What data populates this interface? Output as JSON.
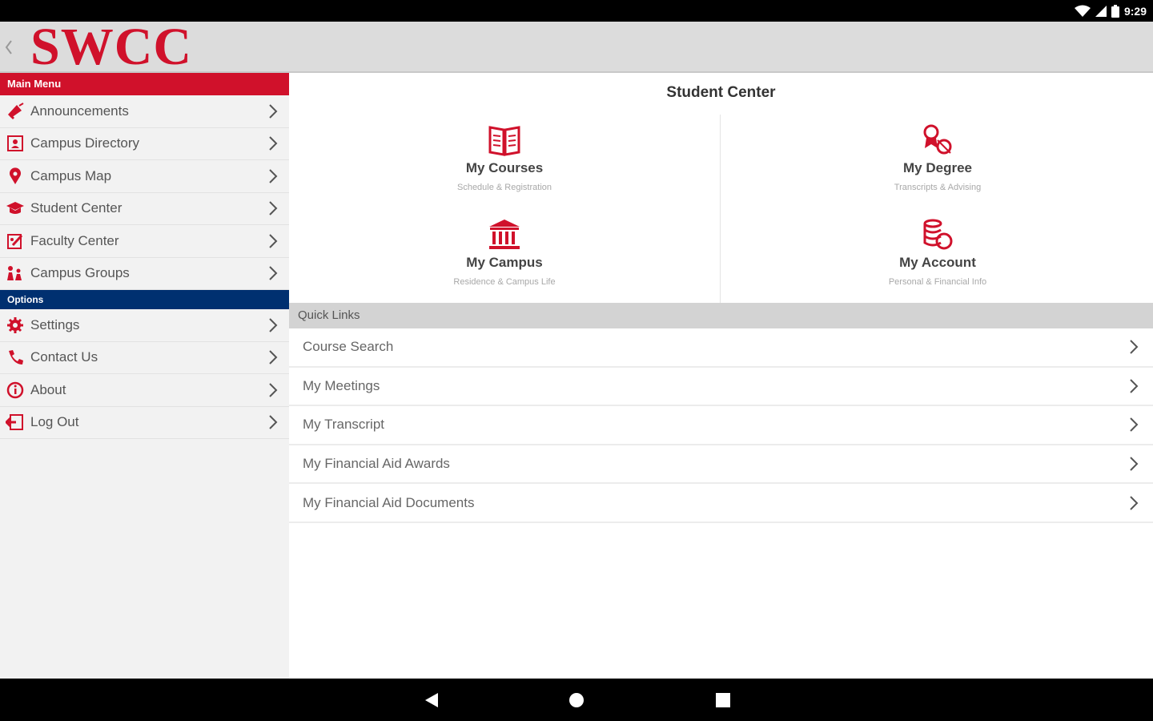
{
  "status_bar": {
    "time": "9:29"
  },
  "header": {
    "logo_text": "SWCC"
  },
  "sidebar": {
    "main_menu_label": "Main Menu",
    "main_items": [
      {
        "label": "Announcements",
        "icon": "megaphone-icon"
      },
      {
        "label": "Campus Directory",
        "icon": "contact-card-icon"
      },
      {
        "label": "Campus Map",
        "icon": "map-pin-icon"
      },
      {
        "label": "Student Center",
        "icon": "graduation-cap-icon"
      },
      {
        "label": "Faculty Center",
        "icon": "faculty-icon"
      },
      {
        "label": "Campus Groups",
        "icon": "groups-icon"
      }
    ],
    "options_label": "Options",
    "option_items": [
      {
        "label": "Settings",
        "icon": "gear-icon"
      },
      {
        "label": "Contact Us",
        "icon": "phone-icon"
      },
      {
        "label": "About",
        "icon": "info-icon"
      },
      {
        "label": "Log Out",
        "icon": "logout-icon"
      }
    ]
  },
  "main": {
    "title": "Student Center",
    "tiles": [
      {
        "title": "My Courses",
        "subtitle": "Schedule & Registration",
        "icon": "book-icon"
      },
      {
        "title": "My Degree",
        "subtitle": "Transcripts & Advising",
        "icon": "degree-icon"
      },
      {
        "title": "My Campus",
        "subtitle": "Residence & Campus Life",
        "icon": "building-icon"
      },
      {
        "title": "My Account",
        "subtitle": "Personal & Financial Info",
        "icon": "coins-icon"
      }
    ],
    "quick_links_label": "Quick Links",
    "quick_links": [
      {
        "label": "Course Search"
      },
      {
        "label": "My Meetings"
      },
      {
        "label": "My Transcript"
      },
      {
        "label": "My Financial Aid Awards"
      },
      {
        "label": "My Financial Aid Documents"
      }
    ]
  },
  "colors": {
    "brand_red": "#d0112b",
    "options_blue": "#003070"
  }
}
